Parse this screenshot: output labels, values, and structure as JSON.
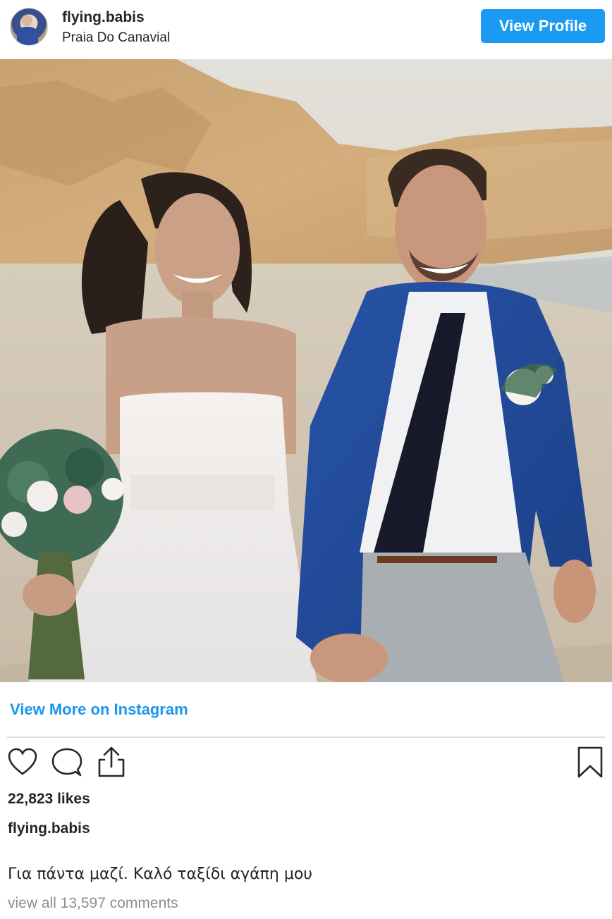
{
  "header": {
    "username": "flying.babis",
    "location": "Praia Do Canavial",
    "view_profile_label": "View Profile"
  },
  "post": {
    "image_alt": "Bride and groom walking hand in hand on a beach below sandstone cliffs"
  },
  "links": {
    "view_more": "View More on Instagram"
  },
  "actions": {
    "like_icon": "heart-icon",
    "comment_icon": "comment-icon",
    "share_icon": "share-icon",
    "save_icon": "bookmark-icon"
  },
  "stats": {
    "likes": "22,823 likes"
  },
  "caption": {
    "username": "flying.babis",
    "text": "Για πάντα μαζί. Καλό ταξίδι αγάπη μου"
  },
  "comments": {
    "view_all": "view all 13,597 comments"
  },
  "colors": {
    "accent": "#1a9af3",
    "link": "#1a95f0",
    "muted": "#8e8e8e",
    "text": "#262626"
  }
}
